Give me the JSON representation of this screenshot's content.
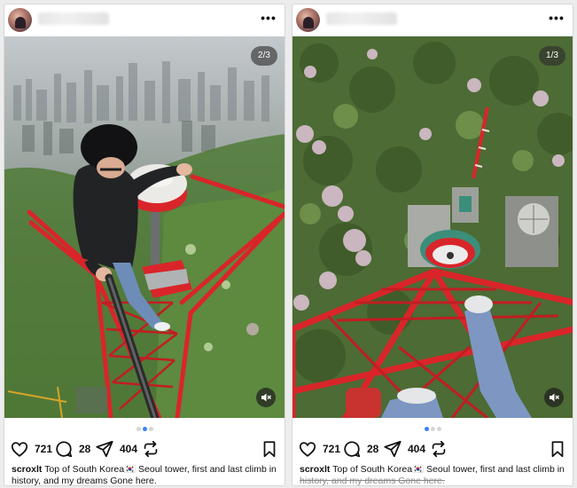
{
  "posts": [
    {
      "counter": "2/3",
      "likes": "721",
      "comments": "28",
      "shares": "404",
      "caption_user": "scroxlt",
      "caption_line1": " Top of South Korea🇰🇷 Seoul tower, first and last climb in",
      "caption_line2": "history, and my dreams Gone here.",
      "caption_line2_faded": false,
      "carousel_total": 3,
      "carousel_active": 2
    },
    {
      "counter": "1/3",
      "likes": "721",
      "comments": "28",
      "shares": "404",
      "caption_user": "scroxlt",
      "caption_line1": " Top of South Korea🇰🇷 Seoul tower, first and last climb in",
      "caption_line2": "history, and my dreams Gone here.",
      "caption_line2_faded": true,
      "carousel_total": 3,
      "carousel_active": 1
    }
  ],
  "icons": {
    "more": "more-icon",
    "like": "heart-icon",
    "comment": "comment-icon",
    "share": "send-icon",
    "repost": "repost-icon",
    "save": "bookmark-icon",
    "mute": "speaker-muted-icon"
  },
  "colors": {
    "accent_dot": "#3b82f6",
    "tower_red": "#d9252a"
  }
}
